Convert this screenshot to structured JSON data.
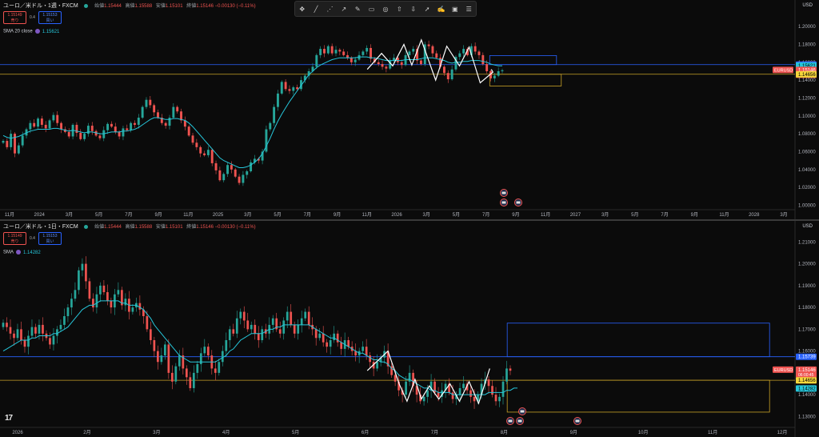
{
  "toolbar": {
    "icons": [
      "crosshair-icon",
      "trend-line-icon",
      "path-icon",
      "ray-icon",
      "pencil-icon",
      "rectangle-icon",
      "circle-icon",
      "long-position-icon",
      "short-position-icon",
      "arrow-icon",
      "text-callout-icon",
      "image-icon",
      "list-icon"
    ],
    "glyphs": [
      "✥",
      "╱",
      "⋰",
      "↗",
      "✎",
      "▭",
      "◎",
      "⇧",
      "⇩",
      "➚",
      "✍",
      "▣",
      "☰"
    ]
  },
  "top": {
    "symbol": "ユーロ／米ドル・1週・FXCM",
    "open_label": "始値",
    "open": "1.15444",
    "high_label": "高値",
    "high": "1.15588",
    "low_label": "安値",
    "low": "1.15101",
    "close_label": "終値",
    "close": "1.15146",
    "change": "−0.00130 (−0.11%)",
    "sell_price": "1.15149",
    "sell_label": "売り",
    "spread": "0.4",
    "buy_price": "1.15153",
    "buy_label": "買い",
    "sma_label": "SMA 20 close",
    "sma_value": "1.15621",
    "currency": "USD"
  },
  "bottom": {
    "symbol": "ユーロ／米ドル・1日・FXCM",
    "open_label": "始値",
    "open": "1.15444",
    "high_label": "高値",
    "high": "1.15588",
    "low_label": "安値",
    "low": "1.15101",
    "close_label": "終値",
    "close": "1.15146",
    "change": "−0.00130 (−0.11%)",
    "sell_price": "1.15149",
    "sell_label": "売り",
    "spread": "0.4",
    "buy_price": "1.15153",
    "buy_label": "買い",
    "sma_label": "SMA",
    "sma_value": "1.14282",
    "currency": "USD"
  },
  "colors": {
    "up": "#26a69a",
    "down": "#ef5350",
    "sma": "#26c6da",
    "blue_line": "#2962ff",
    "yellow_line": "#c9a227",
    "zigzag": "#ffffff"
  },
  "chart_data": [
    {
      "type": "candlestick",
      "title": "ユーロ／米ドル・1週・FXCM",
      "ylim": [
        0.995,
        1.21
      ],
      "y_ticks": [
        "1.20000",
        "1.18000",
        "1.16000",
        "1.14000",
        "1.12000",
        "1.10000",
        "1.08000",
        "1.06000",
        "1.04000",
        "1.02000",
        "1.00000"
      ],
      "x_tick_labels": [
        "11月",
        "2024",
        "3月",
        "5月",
        "7月",
        "9月",
        "11月",
        "2025",
        "3月",
        "5月",
        "7月",
        "9月",
        "11月",
        "2026",
        "3月",
        "5月",
        "7月",
        "9月",
        "11月",
        "2027",
        "3月",
        "5月",
        "7月",
        "9月",
        "11月",
        "2028",
        "3月"
      ],
      "key_values": [
        "1.20000",
        "1.18000",
        "1.16000",
        "1.14000",
        "1.12000",
        "1.10000",
        "1.08000",
        "1.06000",
        "1.04000",
        "1.02000",
        "1.00000",
        "1.15739",
        "1.15621",
        "1.15146",
        "1.14656"
      ],
      "price_labels": [
        {
          "label": "1.15739",
          "value": 1.15739,
          "color": "#2962ff"
        },
        {
          "label": "1.15621",
          "value": 1.15621,
          "color": "#26c6da"
        },
        {
          "label": "1.15146",
          "value": 1.15146,
          "color": "#ef5350",
          "sub": "4d 7h"
        },
        {
          "label": "1.14656",
          "value": 1.14656,
          "color": "#f5d63b"
        }
      ],
      "symbol_tag": "EURUSD",
      "horizontal_lines": [
        {
          "value": 1.1574,
          "color": "#2962ff"
        },
        {
          "value": 1.1466,
          "color": "#c9a227"
        }
      ],
      "rectangles": [
        {
          "x0": 0.616,
          "x1": 0.7,
          "y0": 1.1574,
          "y1": 1.1675,
          "color": "#2962ff"
        },
        {
          "x0": 0.616,
          "x1": 0.706,
          "y0": 1.1466,
          "y1": 1.1335,
          "color": "#c9a227"
        }
      ],
      "zigzag": [
        [
          0.462,
          1.152
        ],
        [
          0.48,
          1.17
        ],
        [
          0.494,
          1.156
        ],
        [
          0.508,
          1.18
        ],
        [
          0.518,
          1.157
        ],
        [
          0.53,
          1.185
        ],
        [
          0.548,
          1.14
        ],
        [
          0.562,
          1.178
        ],
        [
          0.578,
          1.156
        ],
        [
          0.59,
          1.177
        ],
        [
          0.604,
          1.137
        ],
        [
          0.62,
          1.149
        ],
        [
          0.618,
          1.152
        ]
      ],
      "closes": [
        1.072,
        1.065,
        1.08,
        1.058,
        1.067,
        1.078,
        1.085,
        1.092,
        1.088,
        1.097,
        1.09,
        1.086,
        1.095,
        1.101,
        1.092,
        1.085,
        1.082,
        1.077,
        1.09,
        1.081,
        1.074,
        1.08,
        1.089,
        1.083,
        1.078,
        1.075,
        1.084,
        1.091,
        1.088,
        1.082,
        1.077,
        1.086,
        1.084,
        1.092,
        1.09,
        1.098,
        1.11,
        1.118,
        1.112,
        1.104,
        1.098,
        1.092,
        1.089,
        1.098,
        1.11,
        1.105,
        1.095,
        1.088,
        1.078,
        1.07,
        1.065,
        1.058,
        1.056,
        1.062,
        1.047,
        1.039,
        1.028,
        1.035,
        1.045,
        1.04,
        1.032,
        1.025,
        1.034,
        1.038,
        1.048,
        1.052,
        1.05,
        1.06,
        1.085,
        1.092,
        1.11,
        1.125,
        1.138,
        1.13,
        1.128,
        1.132,
        1.13,
        1.14,
        1.145,
        1.15,
        1.155,
        1.168,
        1.175,
        1.17,
        1.178,
        1.17,
        1.174,
        1.172,
        1.168,
        1.165,
        1.16,
        1.163,
        1.168,
        1.172,
        1.176,
        1.164,
        1.16,
        1.158,
        1.155,
        1.153,
        1.162,
        1.165,
        1.16,
        1.157,
        1.168,
        1.172,
        1.175,
        1.162,
        1.158,
        1.18,
        1.178,
        1.17,
        1.165,
        1.155,
        1.148,
        1.141,
        1.152,
        1.166,
        1.17,
        1.175,
        1.168,
        1.178,
        1.172,
        1.168,
        1.158,
        1.15,
        1.142,
        1.145,
        1.15,
        1.151
      ],
      "sma": [
        1.078,
        1.076,
        1.075,
        1.076,
        1.077,
        1.079,
        1.081,
        1.083,
        1.084,
        1.085,
        1.085,
        1.085,
        1.085,
        1.086,
        1.086,
        1.085,
        1.084,
        1.083,
        1.084,
        1.083,
        1.082,
        1.081,
        1.082,
        1.082,
        1.081,
        1.08,
        1.08,
        1.081,
        1.082,
        1.082,
        1.082,
        1.083,
        1.083,
        1.084,
        1.085,
        1.087,
        1.09,
        1.093,
        1.096,
        1.098,
        1.098,
        1.097,
        1.096,
        1.096,
        1.097,
        1.097,
        1.096,
        1.095,
        1.092,
        1.088,
        1.083,
        1.078,
        1.073,
        1.068,
        1.063,
        1.058,
        1.053,
        1.05,
        1.048,
        1.046,
        1.044,
        1.042,
        1.042,
        1.043,
        1.045,
        1.048,
        1.052,
        1.058,
        1.066,
        1.075,
        1.085,
        1.094,
        1.102,
        1.109,
        1.116,
        1.122,
        1.128,
        1.134,
        1.14,
        1.146,
        1.15,
        1.154,
        1.157,
        1.159,
        1.161,
        1.163,
        1.164,
        1.165,
        1.165,
        1.165,
        1.165,
        1.165,
        1.166,
        1.166,
        1.166,
        1.165,
        1.165,
        1.164,
        1.163,
        1.162,
        1.162,
        1.162,
        1.162,
        1.162,
        1.163,
        1.163,
        1.163,
        1.163,
        1.164,
        1.165,
        1.165,
        1.165,
        1.164,
        1.163,
        1.162,
        1.16,
        1.159,
        1.16,
        1.16,
        1.161,
        1.161,
        1.162,
        1.162,
        1.162,
        1.161,
        1.16,
        1.158,
        1.157,
        1.156,
        1.156
      ],
      "event_markers": [
        "flag-icon",
        "flag-icon",
        "flag-icon"
      ]
    },
    {
      "type": "candlestick",
      "title": "ユーロ／米ドル・1日・FXCM",
      "ylim": [
        1.125,
        1.216
      ],
      "y_ticks": [
        "1.21000",
        "1.20000",
        "1.19000",
        "1.18000",
        "1.17000",
        "1.16000",
        "1.15000",
        "1.14000",
        "1.13000"
      ],
      "x_tick_labels": [
        "2026",
        "2月",
        "3月",
        "4月",
        "5月",
        "6月",
        "7月",
        "8月",
        "9月",
        "10月",
        "11月",
        "12月"
      ],
      "key_values": [
        "1.21000",
        "1.20000",
        "1.19000",
        "1.18000",
        "1.17000",
        "1.16000",
        "1.15000",
        "1.14000",
        "1.13000",
        "1.15739",
        "1.15146",
        "1.14656",
        "1.14282"
      ],
      "price_labels": [
        {
          "label": "1.15739",
          "value": 1.15739,
          "color": "#2962ff"
        },
        {
          "label": "1.15146",
          "value": 1.15146,
          "color": "#ef5350",
          "sub": "06:00:45"
        },
        {
          "label": "1.14656",
          "value": 1.14656,
          "color": "#f5d63b"
        },
        {
          "label": "1.14282",
          "value": 1.14282,
          "color": "#26c6da"
        }
      ],
      "symbol_tag": "EURUSD",
      "horizontal_lines": [
        {
          "value": 1.1574,
          "color": "#2962ff"
        },
        {
          "value": 1.1466,
          "color": "#c9a227"
        }
      ],
      "rectangles": [
        {
          "x0": 0.638,
          "x1": 0.968,
          "y0": 1.1574,
          "y1": 1.1728,
          "color": "#2962ff"
        },
        {
          "x0": 0.638,
          "x1": 0.968,
          "y0": 1.1466,
          "y1": 1.132,
          "color": "#c9a227"
        }
      ],
      "zigzag": [
        [
          0.462,
          1.151
        ],
        [
          0.488,
          1.16
        ],
        [
          0.502,
          1.145
        ],
        [
          0.512,
          1.137
        ],
        [
          0.522,
          1.147
        ],
        [
          0.53,
          1.138
        ],
        [
          0.54,
          1.144
        ],
        [
          0.552,
          1.138
        ],
        [
          0.566,
          1.145
        ],
        [
          0.578,
          1.137
        ],
        [
          0.59,
          1.146
        ],
        [
          0.602,
          1.136
        ],
        [
          0.616,
          1.152
        ]
      ],
      "closes": [
        1.173,
        1.171,
        1.168,
        1.166,
        1.17,
        1.165,
        1.162,
        1.167,
        1.171,
        1.168,
        1.172,
        1.168,
        1.166,
        1.163,
        1.167,
        1.17,
        1.172,
        1.176,
        1.18,
        1.184,
        1.188,
        1.197,
        1.2,
        1.192,
        1.184,
        1.18,
        1.186,
        1.19,
        1.187,
        1.183,
        1.18,
        1.186,
        1.188,
        1.181,
        1.184,
        1.178,
        1.18,
        1.182,
        1.179,
        1.176,
        1.17,
        1.165,
        1.16,
        1.155,
        1.158,
        1.163,
        1.15,
        1.146,
        1.153,
        1.158,
        1.152,
        1.148,
        1.143,
        1.15,
        1.154,
        1.159,
        1.162,
        1.158,
        1.152,
        1.15,
        1.155,
        1.16,
        1.165,
        1.17,
        1.168,
        1.175,
        1.178,
        1.174,
        1.17,
        1.172,
        1.168,
        1.165,
        1.17,
        1.168,
        1.172,
        1.175,
        1.17,
        1.168,
        1.174,
        1.178,
        1.172,
        1.168,
        1.172,
        1.175,
        1.178,
        1.172,
        1.17,
        1.166,
        1.168,
        1.164,
        1.162,
        1.165,
        1.168,
        1.164,
        1.161,
        1.165,
        1.162,
        1.16,
        1.158,
        1.16,
        1.162,
        1.158,
        1.155,
        1.152,
        1.155,
        1.157,
        1.16,
        1.153,
        1.149,
        1.146,
        1.142,
        1.14,
        1.146,
        1.15,
        1.144,
        1.14,
        1.137,
        1.139,
        1.142,
        1.146,
        1.141,
        1.139,
        1.142,
        1.145,
        1.141,
        1.138,
        1.14,
        1.143,
        1.145,
        1.142,
        1.139,
        1.137,
        1.14,
        1.145,
        1.147,
        1.144,
        1.14,
        1.137,
        1.139,
        1.146,
        1.152,
        1.151
      ],
      "sma": [
        1.16,
        1.161,
        1.162,
        1.163,
        1.164,
        1.165,
        1.165,
        1.165,
        1.166,
        1.166,
        1.167,
        1.167,
        1.167,
        1.167,
        1.168,
        1.168,
        1.169,
        1.17,
        1.171,
        1.173,
        1.175,
        1.177,
        1.179,
        1.18,
        1.181,
        1.181,
        1.182,
        1.183,
        1.183,
        1.183,
        1.183,
        1.183,
        1.183,
        1.182,
        1.182,
        1.181,
        1.181,
        1.181,
        1.18,
        1.179,
        1.177,
        1.175,
        1.172,
        1.17,
        1.168,
        1.166,
        1.164,
        1.162,
        1.16,
        1.158,
        1.157,
        1.156,
        1.155,
        1.155,
        1.155,
        1.155,
        1.155,
        1.155,
        1.155,
        1.155,
        1.156,
        1.157,
        1.158,
        1.16,
        1.161,
        1.163,
        1.165,
        1.166,
        1.167,
        1.168,
        1.168,
        1.168,
        1.168,
        1.169,
        1.17,
        1.17,
        1.171,
        1.171,
        1.172,
        1.172,
        1.172,
        1.172,
        1.172,
        1.172,
        1.172,
        1.172,
        1.171,
        1.17,
        1.169,
        1.168,
        1.167,
        1.166,
        1.166,
        1.165,
        1.164,
        1.163,
        1.162,
        1.161,
        1.16,
        1.159,
        1.159,
        1.158,
        1.157,
        1.156,
        1.156,
        1.155,
        1.155,
        1.154,
        1.152,
        1.151,
        1.149,
        1.148,
        1.147,
        1.147,
        1.146,
        1.145,
        1.144,
        1.143,
        1.143,
        1.142,
        1.142,
        1.141,
        1.141,
        1.141,
        1.141,
        1.14,
        1.14,
        1.14,
        1.14,
        1.14,
        1.14,
        1.14,
        1.14,
        1.14,
        1.14,
        1.141,
        1.141,
        1.141,
        1.141,
        1.141,
        1.142,
        1.142,
        1.143,
        1.143
      ]
    }
  ]
}
